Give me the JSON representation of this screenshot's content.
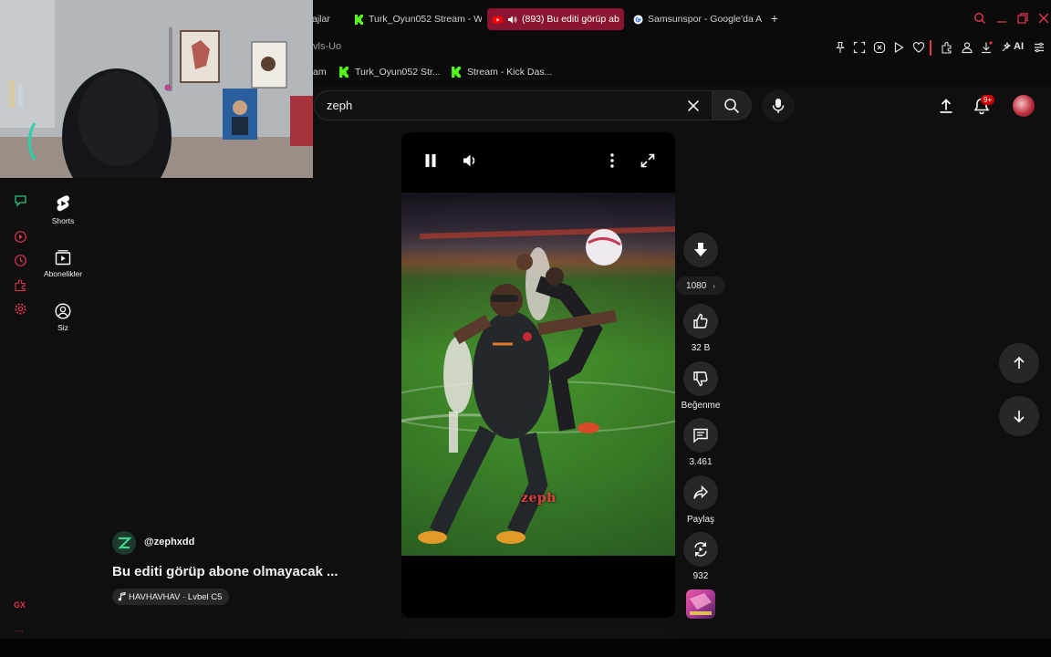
{
  "browser": {
    "tabs": [
      {
        "label": "ajlar",
        "icon": "none",
        "active": false
      },
      {
        "label": "Turk_Oyun052 Stream - W",
        "icon": "kick-icon",
        "active": false
      },
      {
        "label": "(893) Bu editi görüp ab",
        "icon": "youtube-icon",
        "active": true
      },
      {
        "label": "Samsunspor - Google'da A",
        "icon": "google-icon",
        "active": false
      }
    ],
    "url_fragment": "vls-Uo",
    "ai_label": "AI",
    "bookmarks": [
      {
        "label": "am",
        "icon": "none"
      },
      {
        "label": "Turk_Oyun052 Str...",
        "icon": "kick-icon"
      },
      {
        "label": "Stream - Kick Das...",
        "icon": "kick-icon"
      }
    ],
    "accent_color": "#e0354f",
    "gx_label": "GX",
    "gx_more": "..."
  },
  "guide": {
    "items": [
      {
        "label": "Shorts",
        "icon": "shorts-icon"
      },
      {
        "label": "Abonelikler",
        "icon": "subscriptions-icon"
      },
      {
        "label": "Siz",
        "icon": "account-icon"
      }
    ]
  },
  "search": {
    "query": "zeph"
  },
  "header": {
    "notification_badge": "9+"
  },
  "player": {
    "watermark": "zeph",
    "quality": "1080"
  },
  "actions": {
    "like_count": "32 B",
    "dislike_label": "Beğenme",
    "comment_count": "3.461",
    "share_label": "Paylaş",
    "remix_count": "932"
  },
  "video": {
    "channel": "@zephxdd",
    "title": "Bu editi görüp abone olmayacak ...",
    "audio": "HAVHAVHAV · Lvbel C5"
  }
}
